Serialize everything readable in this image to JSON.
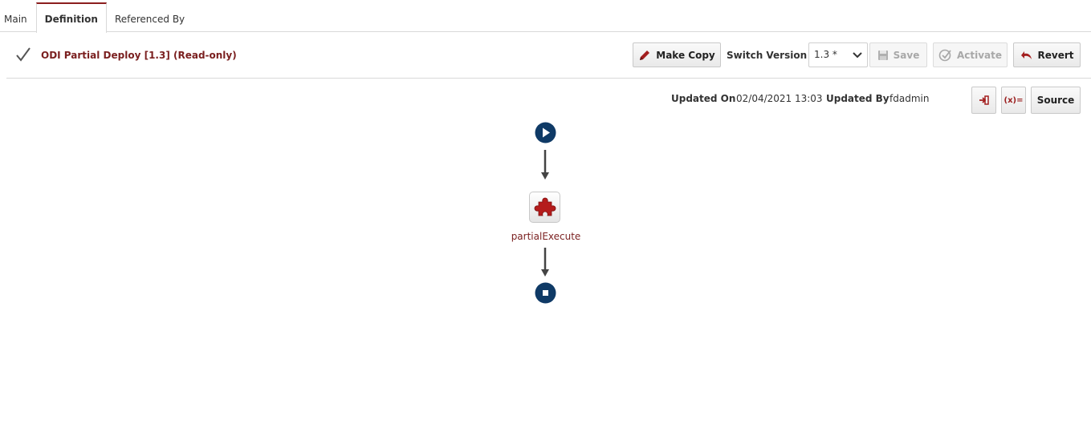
{
  "tabs": [
    {
      "label": "Main",
      "active": false
    },
    {
      "label": "Definition",
      "active": true
    },
    {
      "label": "Referenced By",
      "active": false
    }
  ],
  "header": {
    "status_icon": "checkmark-icon",
    "title": "ODI Partial Deploy [1.3] (Read-only)",
    "make_copy_label": "Make Copy",
    "switch_version_label": "Switch Version",
    "version_selected": "1.3 *",
    "save_label": "Save",
    "activate_label": "Activate",
    "revert_label": "Revert"
  },
  "meta": {
    "updated_on_label": "Updated On",
    "updated_on_value": "02/04/2021 13:03",
    "updated_by_label": "Updated By",
    "updated_by_value": "fdadmin"
  },
  "toolbar": {
    "import_icon": "import-icon",
    "variables_label": "(x)=",
    "source_label": "Source"
  },
  "flow": {
    "start_icon": "play-icon",
    "task_icon": "puzzle-piece-icon",
    "task_label": "partialExecute",
    "end_icon": "stop-icon"
  },
  "colors": {
    "accent": "#7a1f1f",
    "node_blue": "#0f3a66",
    "task_red": "#b51c1c"
  }
}
